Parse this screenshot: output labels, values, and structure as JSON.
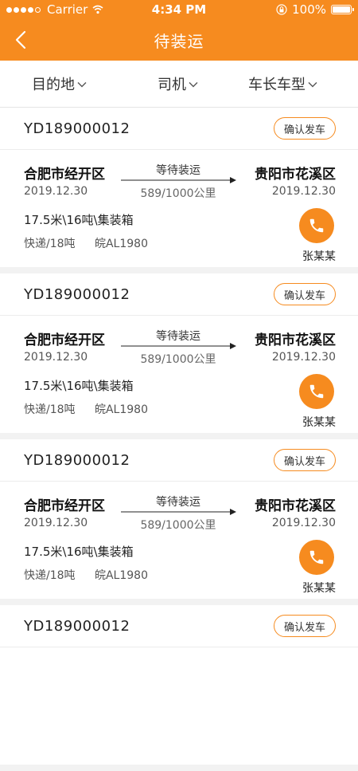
{
  "status_bar": {
    "carrier": "Carrier",
    "time": "4:34 PM",
    "battery": "100%"
  },
  "header": {
    "title": "待装运",
    "background": "#f68b1f"
  },
  "filters": [
    {
      "label": "目的地"
    },
    {
      "label": "司机"
    },
    {
      "label": "车长车型"
    }
  ],
  "orders": [
    {
      "order_no": "YD189000012",
      "confirm_label": "确认发车",
      "from_city": "合肥市经开区",
      "from_date": "2019.12.30",
      "to_city": "贵阳市花溪区",
      "to_date": "2019.12.30",
      "status": "等待装运",
      "distance": "589/1000公里",
      "cargo": "17.5米\\16吨\\集装箱",
      "goods": "快递/18吨",
      "plate": "皖AL1980",
      "driver": "张某某"
    },
    {
      "order_no": "YD189000012",
      "confirm_label": "确认发车",
      "from_city": "合肥市经开区",
      "from_date": "2019.12.30",
      "to_city": "贵阳市花溪区",
      "to_date": "2019.12.30",
      "status": "等待装运",
      "distance": "589/1000公里",
      "cargo": "17.5米\\16吨\\集装箱",
      "goods": "快递/18吨",
      "plate": "皖AL1980",
      "driver": "张某某"
    },
    {
      "order_no": "YD189000012",
      "confirm_label": "确认发车",
      "from_city": "合肥市经开区",
      "from_date": "2019.12.30",
      "to_city": "贵阳市花溪区",
      "to_date": "2019.12.30",
      "status": "等待装运",
      "distance": "589/1000公里",
      "cargo": "17.5米\\16吨\\集装箱",
      "goods": "快递/18吨",
      "plate": "皖AL1980",
      "driver": "张某某"
    },
    {
      "order_no": "YD189000012",
      "confirm_label": "确认发车"
    }
  ]
}
